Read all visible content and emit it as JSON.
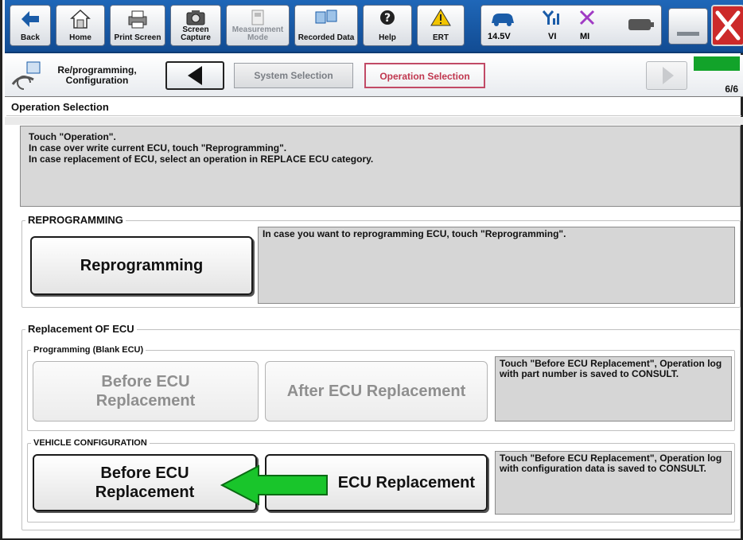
{
  "toolbar": {
    "back": "Back",
    "home": "Home",
    "print_screen": "Print Screen",
    "screen_capture": "Screen Capture",
    "measurement_mode": "Measurement Mode",
    "recorded_data": "Recorded Data",
    "help": "Help",
    "ert": "ERT",
    "voltage": "14.5V",
    "vi": "VI",
    "mi": "MI"
  },
  "nav": {
    "app_title": "Re/programming, Configuration",
    "crumb_system": "System Selection",
    "crumb_operation": "Operation Selection",
    "page_indicator": "6/6",
    "progress_fraction": 1.0
  },
  "section_title": "Operation Selection",
  "instructions": {
    "line1": "Touch \"Operation\".",
    "line2": "In case over write current ECU, touch \"Reprogramming\".",
    "line3": "In case replacement of ECU, select an operation in REPLACE ECU category."
  },
  "reprogramming": {
    "title": "REPROGRAMMING",
    "button": "Reprogramming",
    "description": "In case you want to reprogramming ECU, touch \"Reprogramming\"."
  },
  "replacement": {
    "title": "Replacement OF ECU",
    "blank": {
      "title": "Programming (Blank ECU)",
      "before_line1": "Before ECU",
      "before_line2": "Replacement",
      "after": "After ECU Replacement",
      "description": "Touch \"Before ECU Replacement\", Operation log with part number is saved to CONSULT."
    },
    "vehicle_config": {
      "title": "VEHICLE CONFIGURATION",
      "before_line1": "Before ECU",
      "before_line2": "Replacement",
      "after": "ECU Replacement",
      "description": "Touch \"Before ECU Replacement\", Operation log with configuration data is saved to CONSULT."
    }
  },
  "colors": {
    "toolbar_blue": "#1a5ca8",
    "active_crumb": "#c0374f",
    "progress_green": "#12a32a",
    "arrow_green": "#19c52b",
    "close_red": "#cc2a2a"
  }
}
